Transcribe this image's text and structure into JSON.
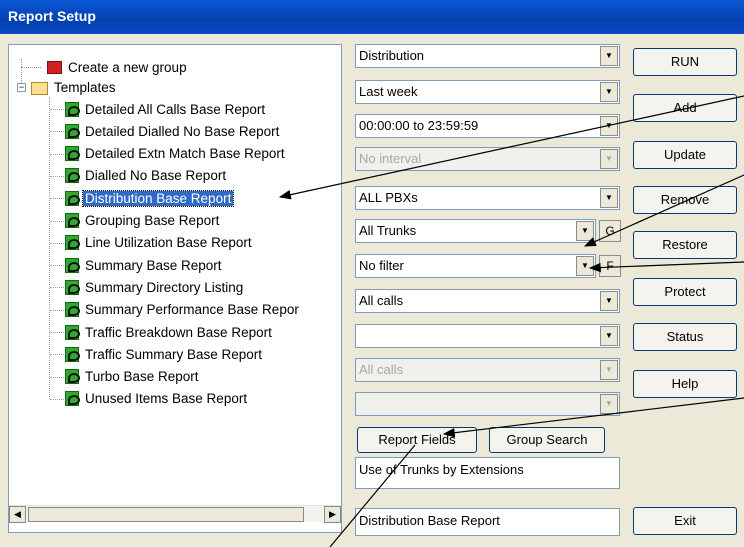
{
  "window": {
    "title": "Report Setup"
  },
  "tree": {
    "create_group": "Create a new group",
    "templates_label": "Templates",
    "items": [
      {
        "label": "Detailed All Calls Base Report",
        "selected": false
      },
      {
        "label": "Detailed Dialled No Base Report",
        "selected": false
      },
      {
        "label": "Detailed Extn Match Base Report",
        "selected": false
      },
      {
        "label": "Dialled No Base Report",
        "selected": false
      },
      {
        "label": "Distribution Base Report",
        "selected": true
      },
      {
        "label": "Grouping Base Report",
        "selected": false
      },
      {
        "label": "Line Utilization Base Report",
        "selected": false
      },
      {
        "label": "Summary Base Report",
        "selected": false
      },
      {
        "label": "Summary Directory Listing",
        "selected": false
      },
      {
        "label": "Summary Performance Base Repor",
        "selected": false
      },
      {
        "label": "Traffic Breakdown Base Report",
        "selected": false
      },
      {
        "label": "Traffic Summary Base Report",
        "selected": false
      },
      {
        "label": "Turbo Base Report",
        "selected": false
      },
      {
        "label": "Unused Items Base Report",
        "selected": false
      }
    ]
  },
  "combos": [
    {
      "value": "Distribution",
      "disabled": false
    },
    {
      "value": "Last week",
      "disabled": false
    },
    {
      "value": "00:00:00 to 23:59:59",
      "disabled": false
    },
    {
      "value": "No interval",
      "disabled": true
    },
    {
      "value": "ALL PBXs",
      "disabled": false
    },
    {
      "value": "All Trunks",
      "disabled": false,
      "side_button": "G"
    },
    {
      "value": "No filter",
      "disabled": false,
      "side_button": "F"
    },
    {
      "value": "All calls",
      "disabled": false
    },
    {
      "value": "",
      "disabled": false
    },
    {
      "value": "All calls",
      "disabled": true
    },
    {
      "value": "",
      "disabled": true
    }
  ],
  "mid_buttons": {
    "report_fields": "Report Fields",
    "group_search": "Group Search"
  },
  "description": "Use of Trunks by Extensions",
  "report_name": "Distribution Base Report",
  "buttons": {
    "run": "RUN",
    "add": "Add",
    "update": "Update",
    "remove": "Remove",
    "restore": "Restore",
    "protect": "Protect",
    "status": "Status",
    "help": "Help",
    "exit": "Exit"
  },
  "colors": {
    "title_bar": "#0a4ac4",
    "selection": "#316ac5",
    "window_bg": "#ece9d8"
  }
}
